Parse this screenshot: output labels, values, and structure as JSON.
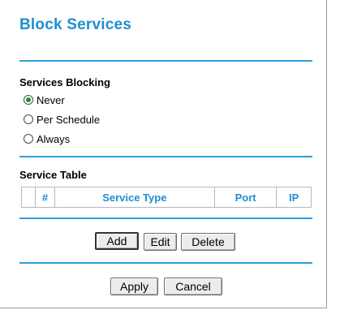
{
  "page": {
    "title": "Block Services"
  },
  "services_blocking": {
    "label": "Services Blocking",
    "options": [
      {
        "label": "Never",
        "selected": true
      },
      {
        "label": "Per Schedule",
        "selected": false
      },
      {
        "label": "Always",
        "selected": false
      }
    ]
  },
  "service_table": {
    "label": "Service Table",
    "columns": [
      "",
      "#",
      "Service Type",
      "Port",
      "IP"
    ]
  },
  "buttons": {
    "add": "Add",
    "edit": "Edit",
    "delete": "Delete",
    "apply": "Apply",
    "cancel": "Cancel"
  },
  "colors": {
    "title": "#1e8fd0",
    "rule": "#2aa0df",
    "radio_selected": "#1d8f2f"
  }
}
